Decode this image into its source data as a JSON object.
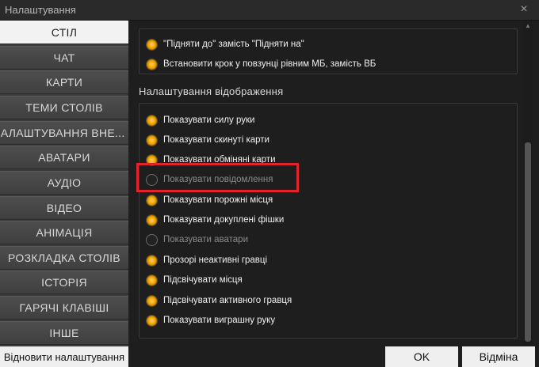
{
  "window": {
    "title": "Налаштування",
    "close_glyph": "×"
  },
  "sidebar": {
    "items": [
      {
        "label": "СТІЛ",
        "active": true
      },
      {
        "label": "ЧАТ"
      },
      {
        "label": "КАРТИ"
      },
      {
        "label": "ТЕМИ СТОЛІВ"
      },
      {
        "label": "НАЛАШТУВАННЯ ВНЕ..."
      },
      {
        "label": "АВАТАРИ"
      },
      {
        "label": "АУДІО"
      },
      {
        "label": "ВІДЕО"
      },
      {
        "label": "АНІМАЦІЯ"
      },
      {
        "label": "РОЗКЛАДКА СТОЛІВ"
      },
      {
        "label": "ІСТОРІЯ"
      },
      {
        "label": "ГАРЯЧІ КЛАВІШІ"
      },
      {
        "label": "ІНШЕ"
      }
    ],
    "restore_button": "Відновити налаштування"
  },
  "content": {
    "top_options": [
      {
        "label": "\"Підняти до\" замість \"Підняти на\"",
        "checked": true
      },
      {
        "label": "Встановити крок у повзунці рівним МБ, замість ВБ",
        "checked": true
      }
    ],
    "display_section_title": "Налаштування відображення",
    "display_options": [
      {
        "label": "Показувати силу руки",
        "checked": true
      },
      {
        "label": "Показувати скинуті карти",
        "checked": true
      },
      {
        "label": "Показувати обміняні карти",
        "checked": true
      },
      {
        "label": "Показувати повідомлення",
        "checked": false
      },
      {
        "label": "Показувати порожні місця",
        "checked": true
      },
      {
        "label": "Показувати докуплені фішки",
        "checked": true
      },
      {
        "label": "Показувати аватари",
        "checked": false
      },
      {
        "label": "Прозорі неактивні гравці",
        "checked": true
      },
      {
        "label": "Підсвічувати місця",
        "checked": true
      },
      {
        "label": "Підсвічувати активного гравця",
        "checked": true
      },
      {
        "label": "Показувати виграшну руку",
        "checked": true
      }
    ]
  },
  "footer": {
    "ok_label": "OK",
    "cancel_label": "Відміна"
  },
  "colors": {
    "accent_radio": "#f6a800",
    "highlight": "#e0242b"
  }
}
